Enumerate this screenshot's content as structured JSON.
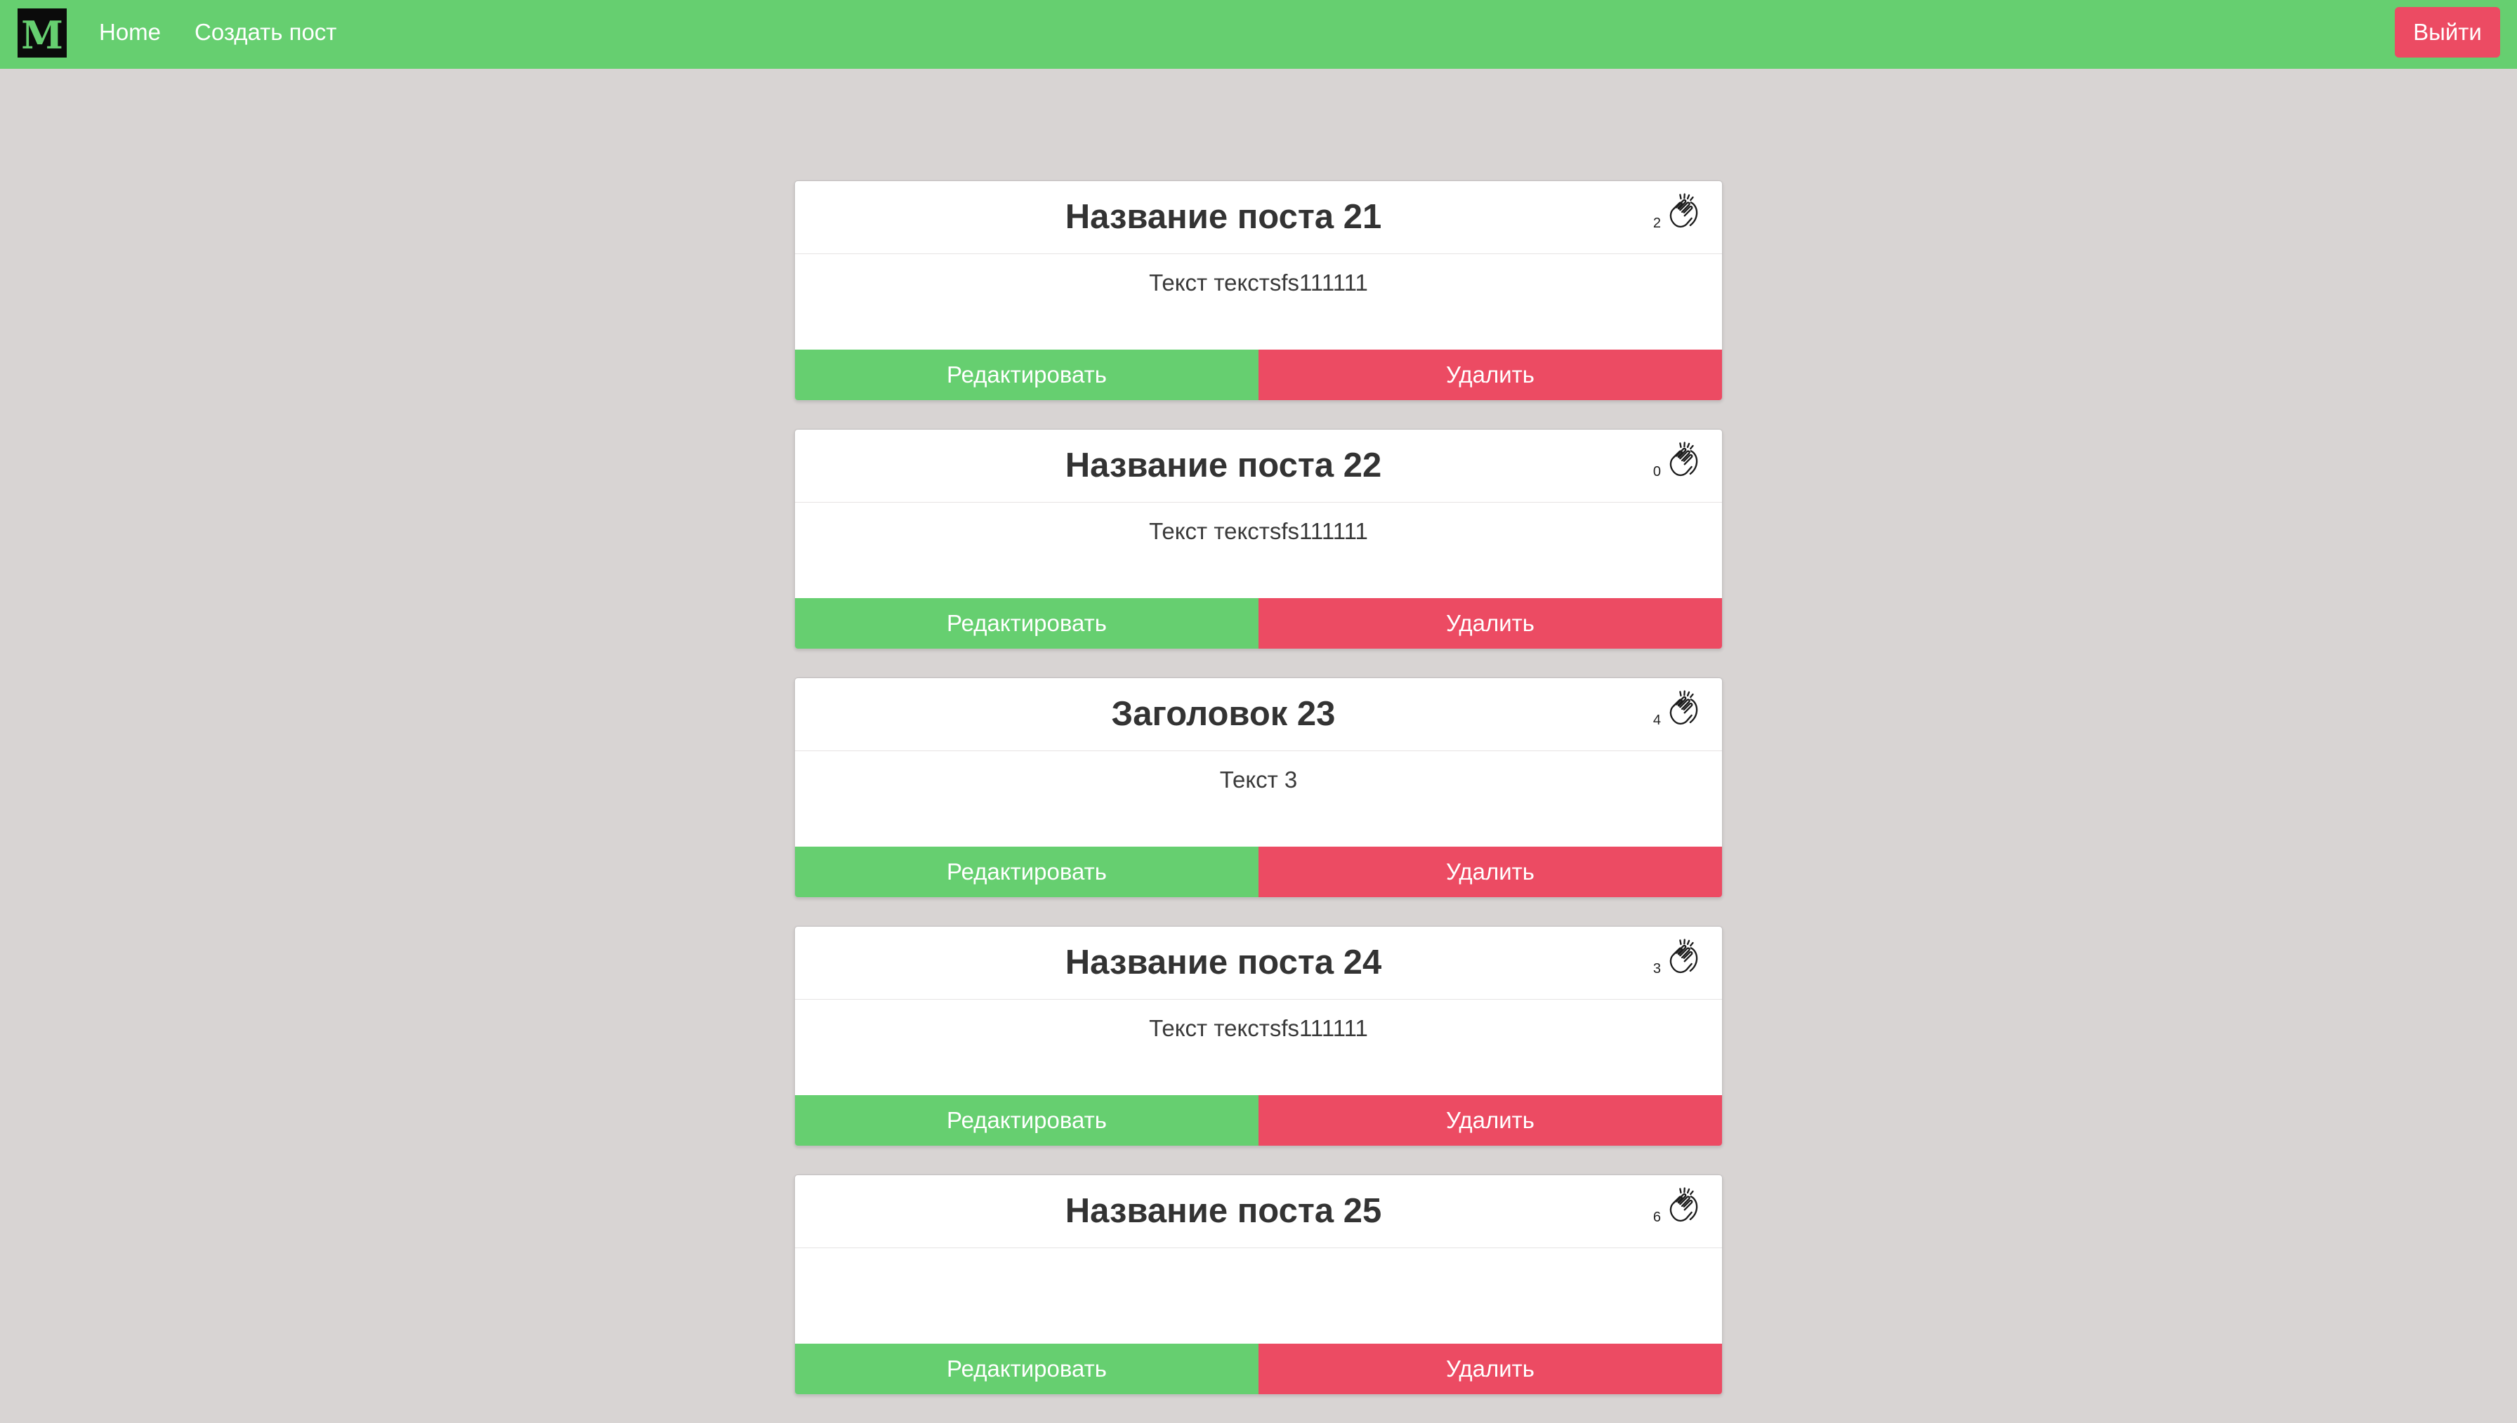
{
  "navbar": {
    "logo_letter": "M",
    "home_label": "Home",
    "create_post_label": "Создать пост",
    "logout_label": "Выйти",
    "bar_color": "#66cf70",
    "logout_color": "#ec4b63"
  },
  "posts": [
    {
      "title": "Название поста 21",
      "claps": "2",
      "body": "Текст текстsfs111111",
      "edit_label": "Редактировать",
      "delete_label": "Удалить"
    },
    {
      "title": "Название поста 22",
      "claps": "0",
      "body": "Текст текстsfs111111",
      "edit_label": "Редактировать",
      "delete_label": "Удалить"
    },
    {
      "title": "Заголовок 23",
      "claps": "4",
      "body": "Текст 3",
      "edit_label": "Редактировать",
      "delete_label": "Удалить"
    },
    {
      "title": "Название поста 24",
      "claps": "3",
      "body": "Текст текстsfs111111",
      "edit_label": "Редактировать",
      "delete_label": "Удалить"
    },
    {
      "title": "Название поста 25",
      "claps": "6",
      "body": "",
      "edit_label": "Редактировать",
      "delete_label": "Удалить"
    }
  ],
  "icons": {
    "clap": "clap-icon"
  }
}
